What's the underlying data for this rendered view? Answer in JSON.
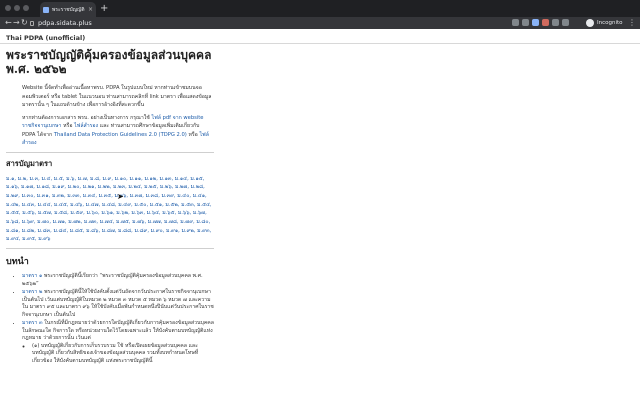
{
  "browser": {
    "tab_title": "พระราชบัญญัติคุ้มครองข้อมูลส่วนบุคคล",
    "tab_close": "×",
    "new_tab": "+",
    "url": "pdpa.sidata.plus",
    "profile_label": "Incognito",
    "back": "←",
    "forward": "→",
    "reload": "↻",
    "menu": "⋮"
  },
  "site": {
    "name": "Thai PDPA (unofficial)"
  },
  "page": {
    "title": "พระราชบัญญัติคุ้มครองข้อมูลส่วนบุคคล พ.ศ. ๒๕๖๒",
    "intro1": "Website นี้จัดทำเพื่ออ่านเนื้อหาพรบ. PDPA ในรูปแบบใหม่ หากท่านเข้าชมบนจอคอมพิวเตอร์ หรือ tablet ในแนวนอน ท่านสามารถคลิกที่ link มาตรา เพื่อแสดงข้อมูลมาตรานั้น ๆ ในแถบด้านข้าง เพื่อการอ้างอิงที่สะดวกขึ้น",
    "intro2_prefix": "หากท่านต้องการเอกสาร พรบ. อย่างเป็นทางการ กรุณาใช้",
    "intro2_link1": "ไฟล์ pdf จาก website ราชกิจจานุเบกษา",
    "intro2_mid1": "หรือ",
    "intro2_link2": "ไฟล์สำรอง",
    "intro2_mid2": "และ ท่านสามารถศึกษาข้อมูลเพิ่มเติมเกี่ยวกับ PDPA ได้จาก",
    "intro2_link3": "Thailand Data Protection Guidelines 2.0 (TDPG 2.0)",
    "intro2_mid3": "หรือ",
    "intro2_link4": "ไฟล์สำรอง",
    "toc_heading": "สารบัญมาตรา",
    "sections": [
      "ม.๑",
      "ม.๒",
      "ม.๓",
      "ม.๔",
      "ม.๕",
      "ม.๖",
      "ม.๗",
      "ม.๘",
      "ม.๙",
      "ม.๑๐",
      "ม.๑๑",
      "ม.๑๒",
      "ม.๑๓",
      "ม.๑๔",
      "ม.๑๕",
      "ม.๑๖",
      "ม.๑๗",
      "ม.๑๘",
      "ม.๑๙",
      "ม.๒๐",
      "ม.๒๑",
      "ม.๒๒",
      "ม.๒๓",
      "ม.๒๔",
      "ม.๒๕",
      "ม.๒๖",
      "ม.๒๗",
      "ม.๒๘",
      "ม.๒๙",
      "ม.๓๐",
      "ม.๓๑",
      "ม.๓๒",
      "ม.๓๓",
      "ม.๓๔",
      "ม.๓๕",
      "ม.๓๖",
      "ม.๓๗",
      "ม.๓๘",
      "ม.๓๙",
      "ม.๔๐",
      "ม.๔๑",
      "ม.๔๒",
      "ม.๔๓",
      "ม.๔๔",
      "ม.๔๕",
      "ม.๔๖",
      "ม.๔๗",
      "ม.๔๘",
      "ม.๔๙",
      "ม.๕๐",
      "ม.๕๑",
      "ม.๕๒",
      "ม.๕๓",
      "ม.๕๔",
      "ม.๕๕",
      "ม.๕๖",
      "ม.๕๗",
      "ม.๕๘",
      "ม.๕๙",
      "ม.๖๐",
      "ม.๖๑",
      "ม.๖๒",
      "ม.๖๓",
      "ม.๖๔",
      "ม.๖๕",
      "ม.๖๖",
      "ม.๖๗",
      "ม.๖๘",
      "ม.๖๙",
      "ม.๗๐",
      "ม.๗๑",
      "ม.๗๒",
      "ม.๗๓",
      "ม.๗๔",
      "ม.๗๕",
      "ม.๗๖",
      "ม.๗๗",
      "ม.๗๘",
      "ม.๗๙",
      "ม.๘๐",
      "ม.๘๑",
      "ม.๘๒",
      "ม.๘๓",
      "ม.๘๔",
      "ม.๘๕",
      "ม.๘๖",
      "ม.๘๗",
      "ม.๘๘",
      "ม.๘๙",
      "ม.๙๐",
      "ม.๙๑",
      "ม.๙๒",
      "ม.๙๓",
      "ม.๙๔",
      "ม.๙๕",
      "ม.๙๖"
    ],
    "body_heading": "บทนำ",
    "bullets": [
      {
        "link": "มาตรา ๑",
        "text": "พระราชบัญญัตินี้เรียกว่า “พระราชบัญญัติคุ้มครองข้อมูลส่วนบุคคล พ.ศ. ๒๕๖๒”"
      },
      {
        "link": "มาตรา ๒",
        "text": "พระราชบัญญัตินี้ให้ใช้บังคับตั้งแต่วันถัดจากวันประกาศในราชกิจจานุเบกษา เป็นต้นไป เว้นแต่บทบัญญัติในหมวด ๒ หมวด ๓ หมวด ๕ หมวด ๖ หมวด ๗ และความใน มาตรา ๙๕ และมาตรา ๙๖ ให้ใช้บังคับเมื่อพ้นกำหนดหนึ่งปีนับแต่วันประกาศในราชกิจจานุเบกษา เป็นต้นไป"
      },
      {
        "link": "มาตรา ๓",
        "text": "ในกรณีที่มีกฎหมายว่าด้วยการใดบัญญัติเกี่ยวกับการคุ้มครองข้อมูลส่วนบุคคล ในลักษณะใด กิจการใด หรือหน่วยงานใดไว้โดยเฉพาะแล้ว ให้บังคับตามบทบัญญัติแห่งกฎหมาย ว่าด้วยการนั้น เว้นแต่"
      }
    ],
    "sub_bullet": "(๑) บทบัญญัติเกี่ยวกับการเก็บรวบรวม ใช้ หรือเปิดเผยข้อมูลส่วนบุคคล และบทบัญญัติ เกี่ยวกับสิทธิของเจ้าของข้อมูลส่วนบุคคล รวมทั้งบทกำหนดโทษที่เกี่ยวข้อง ให้บังคับตามบทบัญญัติ แห่งพระราชบัญญัตินี้"
  },
  "colors": {
    "link": "#1a5aa8",
    "chrome_dark": "#1f2023",
    "chrome_toolbar": "#35363a"
  }
}
